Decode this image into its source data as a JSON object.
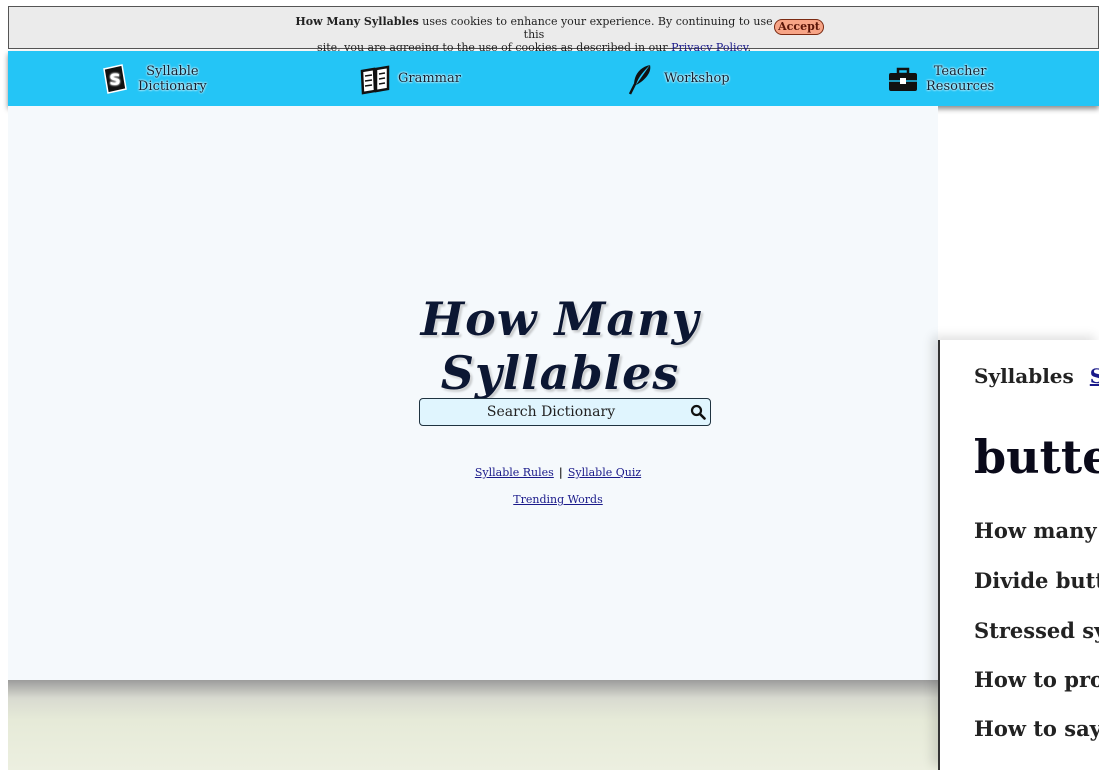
{
  "cookie": {
    "brand": "How Many Syllables",
    "text_1": " uses cookies to enhance your experience. By continuing to use this",
    "text_2": "site, you are agreeing to the use of cookies as described in our ",
    "policy_link": "Privacy Policy",
    "period": ".",
    "accept_label": "Accept"
  },
  "nav": {
    "items": [
      {
        "line1": "Syllable",
        "line2": "Dictionary",
        "icon": "syllable-s-icon"
      },
      {
        "line1": "Grammar",
        "line2": "",
        "icon": "open-book-icon"
      },
      {
        "line1": "Workshop",
        "line2": "",
        "icon": "quill-feather-icon"
      },
      {
        "line1": "Teacher",
        "line2": "Resources",
        "icon": "briefcase-icon"
      }
    ],
    "color": "#24c5f6"
  },
  "hero": {
    "logo_text": "How Many Syllables",
    "search_placeholder": "Search Dictionary",
    "links": {
      "rules": "Syllable Rules",
      "separator": "|",
      "quiz": "Syllable Quiz",
      "trending": "Trending Words"
    }
  },
  "panel": {
    "tab_1": "Syllables",
    "tab_2": "Sy",
    "word": "butte",
    "questions": [
      "How many",
      "Divide butt",
      "Stressed sy",
      "How to pro",
      "How to say"
    ]
  }
}
